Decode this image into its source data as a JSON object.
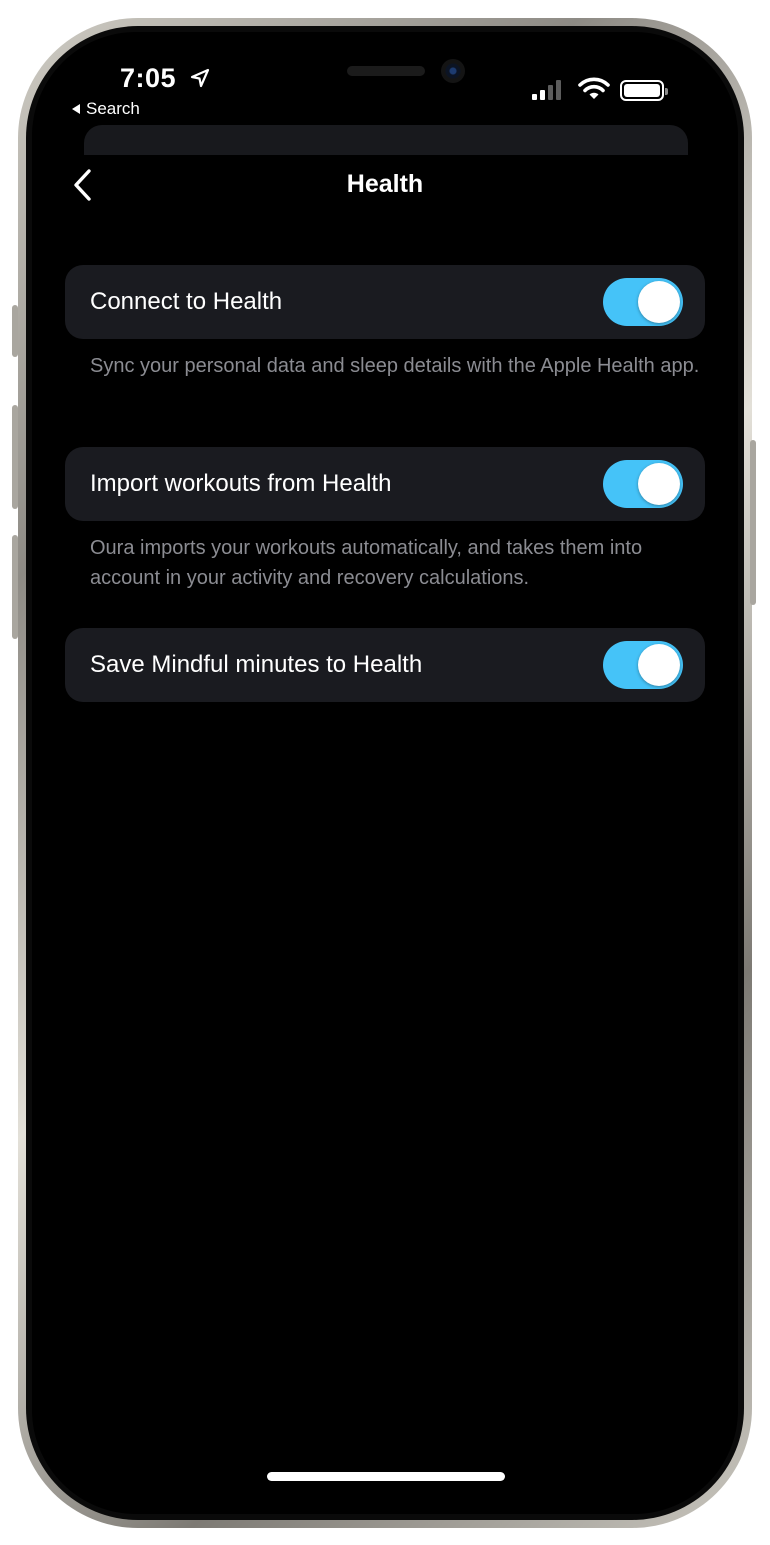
{
  "status_bar": {
    "time": "7:05",
    "back_app": "Search"
  },
  "header": {
    "title": "Health"
  },
  "settings": [
    {
      "label": "Connect to Health",
      "enabled": true,
      "caption": "Sync your personal data and sleep details with the Apple Health app."
    },
    {
      "label": "Import workouts from Health",
      "enabled": true,
      "caption": "Oura imports your workouts automatically, and takes them into account in your activity and recovery calculations."
    },
    {
      "label": "Save Mindful minutes to Health",
      "enabled": true
    }
  ],
  "colors": {
    "toggle_on": "#45c3f8",
    "card_bg": "#1a1b20",
    "caption_text": "#8b8c92",
    "background": "#000000"
  },
  "icons": [
    "location-arrow-icon",
    "back-triangle-icon",
    "cellular-signal-icon",
    "wifi-icon",
    "battery-icon",
    "chevron-left-icon"
  ]
}
